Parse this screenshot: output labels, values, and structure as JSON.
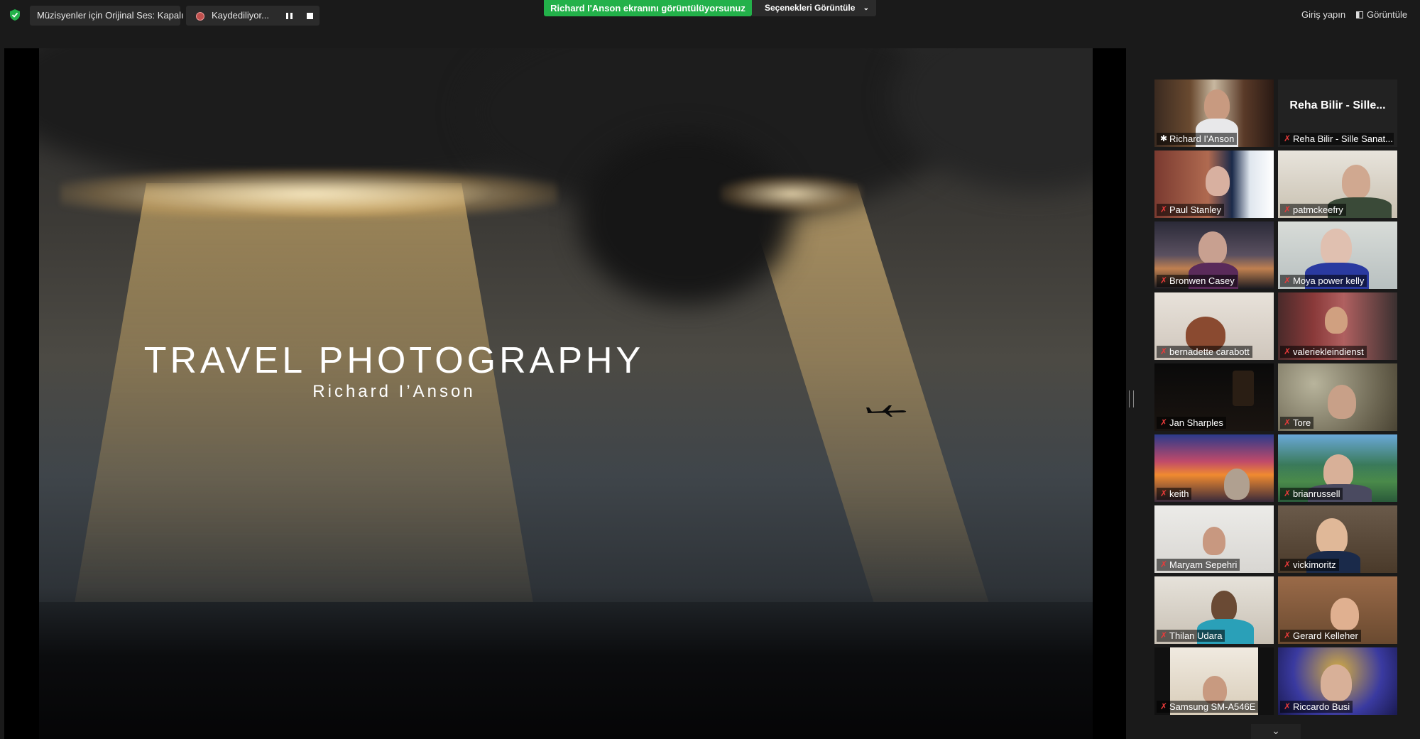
{
  "topbar": {
    "audio_pill": "Müzisyenler için Orijinal Ses: Kapalı",
    "recording_label": "Kaydediliyor...",
    "share_banner": "Richard I'Anson ekranını görüntülüyorsunuz",
    "view_options": "Seçenekleri Görüntüle",
    "sign_in": "Giriş yapın",
    "view": "Görüntüle"
  },
  "slide": {
    "title": "TRAVEL PHOTOGRAPHY",
    "subtitle": "Richard I’Anson"
  },
  "participants": [
    {
      "name": "Richard I'Anson",
      "muted": false,
      "active": true
    },
    {
      "name": "Reha Bilir - Sille Sanat...",
      "muted": true,
      "big_label": "Reha Bilir - Sille..."
    },
    {
      "name": "Paul Stanley",
      "muted": true
    },
    {
      "name": "patmckeefry",
      "muted": true
    },
    {
      "name": "Bronwen Casey",
      "muted": true
    },
    {
      "name": "Moya power kelly",
      "muted": true
    },
    {
      "name": "bernadette carabott",
      "muted": true
    },
    {
      "name": "valeriekleindienst",
      "muted": true
    },
    {
      "name": "Jan Sharples",
      "muted": true
    },
    {
      "name": "Tore",
      "muted": true
    },
    {
      "name": "keith",
      "muted": true
    },
    {
      "name": "brianrussell",
      "muted": true
    },
    {
      "name": "Maryam Sepehri",
      "muted": true
    },
    {
      "name": "vickimoritz",
      "muted": true
    },
    {
      "name": "Thilan Udara",
      "muted": true
    },
    {
      "name": "Gerard Kelleher",
      "muted": true
    },
    {
      "name": "Samsung SM-A546E",
      "muted": true
    },
    {
      "name": "Riccardo Busi",
      "muted": true
    }
  ],
  "colors": {
    "share_green": "#23b14a",
    "active_speaker": "#c8e842",
    "muted_red": "#e83a3a"
  }
}
